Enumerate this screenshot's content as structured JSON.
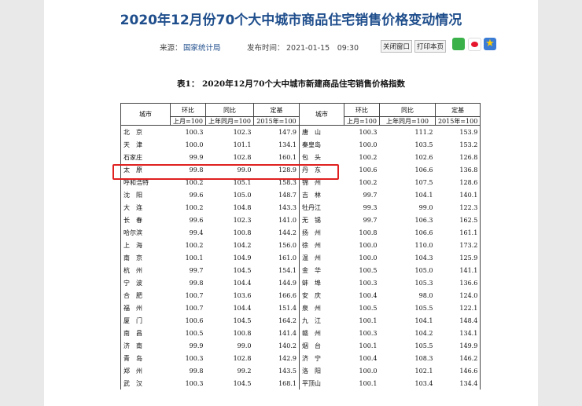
{
  "title": "2020年12月份70个大中城市商品住宅销售价格变动情况",
  "meta": {
    "source_label": "来源：",
    "source": "国家统计局",
    "time_label": "发布时间：",
    "time": "2021-01-15　09:30",
    "close_btn": "关闭窗口",
    "print_btn": "打印本页"
  },
  "icons": [
    "wechat-icon",
    "weibo-icon",
    "favorite-star-icon"
  ],
  "table": {
    "caption": "表1：  2020年12月70个大中城市新建商品住宅销售价格指数",
    "headers": {
      "city": "城市",
      "mom": "环比",
      "mom_sub": "上月=100",
      "yoy": "同比",
      "yoy_sub": "上年同月=100",
      "base": "定基",
      "base_sub": "2015年=100"
    },
    "rows": [
      {
        "c1": "北　京",
        "a1": "100.3",
        "b1": "102.3",
        "d1": "147.9",
        "c2": "唐　山",
        "a2": "100.3",
        "b2": "111.2",
        "d2": "153.9"
      },
      {
        "c1": "天　津",
        "a1": "100.0",
        "b1": "101.1",
        "d1": "134.1",
        "c2": "秦皇岛",
        "a2": "100.0",
        "b2": "103.5",
        "d2": "153.2"
      },
      {
        "c1": "石家庄",
        "a1": "99.9",
        "b1": "102.8",
        "d1": "160.1",
        "c2": "包　头",
        "a2": "100.2",
        "b2": "102.6",
        "d2": "126.8"
      },
      {
        "c1": "太　原",
        "a1": "99.8",
        "b1": "99.0",
        "d1": "128.9",
        "c2": "丹　东",
        "a2": "100.6",
        "b2": "106.6",
        "d2": "136.8"
      },
      {
        "c1": "呼和浩特",
        "a1": "100.2",
        "b1": "105.1",
        "d1": "158.3",
        "c2": "锦　州",
        "a2": "100.2",
        "b2": "107.5",
        "d2": "128.6"
      },
      {
        "c1": "沈　阳",
        "a1": "99.6",
        "b1": "105.0",
        "d1": "148.7",
        "c2": "吉　林",
        "a2": "99.7",
        "b2": "104.1",
        "d2": "140.1"
      },
      {
        "c1": "大　连",
        "a1": "100.2",
        "b1": "104.8",
        "d1": "143.3",
        "c2": "牡丹江",
        "a2": "99.3",
        "b2": "99.0",
        "d2": "122.3"
      },
      {
        "c1": "长　春",
        "a1": "99.6",
        "b1": "102.3",
        "d1": "141.0",
        "c2": "无　锡",
        "a2": "99.7",
        "b2": "106.3",
        "d2": "162.5"
      },
      {
        "c1": "哈尔滨",
        "a1": "99.4",
        "b1": "100.8",
        "d1": "144.2",
        "c2": "扬　州",
        "a2": "100.8",
        "b2": "106.6",
        "d2": "161.1"
      },
      {
        "c1": "上　海",
        "a1": "100.2",
        "b1": "104.2",
        "d1": "156.0",
        "c2": "徐　州",
        "a2": "100.0",
        "b2": "110.0",
        "d2": "173.2"
      },
      {
        "c1": "南　京",
        "a1": "100.1",
        "b1": "104.9",
        "d1": "161.0",
        "c2": "温　州",
        "a2": "100.0",
        "b2": "104.3",
        "d2": "125.9"
      },
      {
        "c1": "杭　州",
        "a1": "99.7",
        "b1": "104.5",
        "d1": "154.1",
        "c2": "金　华",
        "a2": "100.5",
        "b2": "105.0",
        "d2": "141.1"
      },
      {
        "c1": "宁　波",
        "a1": "99.8",
        "b1": "104.4",
        "d1": "144.9",
        "c2": "蚌　埠",
        "a2": "100.3",
        "b2": "105.3",
        "d2": "136.6"
      },
      {
        "c1": "合　肥",
        "a1": "100.7",
        "b1": "103.6",
        "d1": "166.6",
        "c2": "安　庆",
        "a2": "100.4",
        "b2": "98.0",
        "d2": "124.0"
      },
      {
        "c1": "福　州",
        "a1": "100.7",
        "b1": "104.4",
        "d1": "151.4",
        "c2": "泉　州",
        "a2": "100.5",
        "b2": "105.5",
        "d2": "122.1"
      },
      {
        "c1": "厦　门",
        "a1": "100.6",
        "b1": "104.5",
        "d1": "164.2",
        "c2": "九　江",
        "a2": "100.1",
        "b2": "104.1",
        "d2": "148.4"
      },
      {
        "c1": "南　昌",
        "a1": "100.5",
        "b1": "100.8",
        "d1": "141.4",
        "c2": "赣　州",
        "a2": "100.3",
        "b2": "104.2",
        "d2": "134.1"
      },
      {
        "c1": "济　南",
        "a1": "99.9",
        "b1": "99.0",
        "d1": "140.2",
        "c2": "烟　台",
        "a2": "100.1",
        "b2": "105.5",
        "d2": "149.9"
      },
      {
        "c1": "青　岛",
        "a1": "100.3",
        "b1": "102.8",
        "d1": "142.9",
        "c2": "济　宁",
        "a2": "100.4",
        "b2": "108.3",
        "d2": "146.2"
      },
      {
        "c1": "郑　州",
        "a1": "99.8",
        "b1": "99.2",
        "d1": "143.5",
        "c2": "洛　阳",
        "a2": "100.0",
        "b2": "102.1",
        "d2": "146.6"
      },
      {
        "c1": "武　汉",
        "a1": "100.3",
        "b1": "104.5",
        "d1": "168.1",
        "c2": "平顶山",
        "a2": "100.1",
        "b2": "103.4",
        "d2": "134.4"
      }
    ]
  },
  "highlight": {
    "color": "#e02020",
    "row_city": "太　原"
  }
}
